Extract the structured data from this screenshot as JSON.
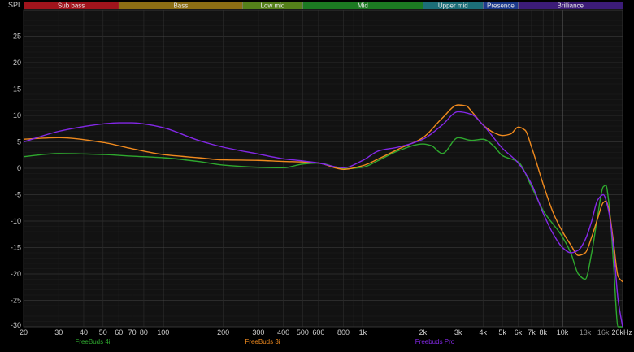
{
  "chart_data": {
    "type": "line",
    "ylabel": "SPL",
    "xunit": "kHz",
    "xscale": "log",
    "xlim": [
      20,
      20000
    ],
    "ylim": [
      -30,
      30
    ],
    "grid": true,
    "legend_placement": "bottom",
    "yticks": [
      25,
      20,
      15,
      10,
      5,
      0,
      -5,
      -10,
      -15,
      -20,
      -25,
      -30
    ],
    "xticks": [
      {
        "value": 20,
        "label": "20"
      },
      {
        "value": 30,
        "label": "30"
      },
      {
        "value": 40,
        "label": "40"
      },
      {
        "value": 50,
        "label": "50"
      },
      {
        "value": 60,
        "label": "60"
      },
      {
        "value": 70,
        "label": "70"
      },
      {
        "value": 80,
        "label": "80"
      },
      {
        "value": 100,
        "label": "100"
      },
      {
        "value": 200,
        "label": "200"
      },
      {
        "value": 300,
        "label": "300"
      },
      {
        "value": 400,
        "label": "400"
      },
      {
        "value": 500,
        "label": "500"
      },
      {
        "value": 600,
        "label": "600"
      },
      {
        "value": 800,
        "label": "800"
      },
      {
        "value": 1000,
        "label": "1k"
      },
      {
        "value": 2000,
        "label": "2k"
      },
      {
        "value": 3000,
        "label": "3k"
      },
      {
        "value": 4000,
        "label": "4k"
      },
      {
        "value": 5000,
        "label": "5k"
      },
      {
        "value": 6000,
        "label": "6k"
      },
      {
        "value": 7000,
        "label": "7k"
      },
      {
        "value": 8000,
        "label": "8k"
      },
      {
        "value": 10000,
        "label": "10k"
      },
      {
        "value": 13000,
        "label": "13k"
      },
      {
        "value": 16000,
        "label": "16k"
      },
      {
        "value": 20000,
        "label": "20kHz"
      }
    ],
    "bands": [
      {
        "label": "Sub bass",
        "from": 20,
        "to": 60,
        "color": "#a0141c"
      },
      {
        "label": "Bass",
        "from": 60,
        "to": 250,
        "color": "#8c6e14"
      },
      {
        "label": "Low mid",
        "from": 250,
        "to": 500,
        "color": "#55801a"
      },
      {
        "label": "Mid",
        "from": 500,
        "to": 2000,
        "color": "#1c7a22"
      },
      {
        "label": "Upper mid",
        "from": 2000,
        "to": 4000,
        "color": "#1c6e78"
      },
      {
        "label": "Presence",
        "from": 4000,
        "to": 6000,
        "color": "#1c3a8c"
      },
      {
        "label": "Brilliance",
        "from": 6000,
        "to": 20000,
        "color": "#3c1c78"
      }
    ],
    "series": [
      {
        "name": "FreeBuds 4i",
        "color": "#2ea82e",
        "x": [
          20,
          30,
          50,
          70,
          100,
          150,
          200,
          300,
          400,
          500,
          600,
          800,
          1000,
          1200,
          1500,
          2000,
          2200,
          2500,
          3000,
          3500,
          4000,
          4500,
          5000,
          6000,
          7000,
          8000,
          10000,
          11000,
          12000,
          13000,
          14000,
          15000,
          16000,
          16500,
          17000,
          17500,
          18000,
          19000,
          20000
        ],
        "y": [
          2.2,
          2.8,
          2.6,
          2.3,
          2.0,
          1.3,
          0.6,
          0.2,
          0.1,
          0.8,
          1.0,
          -0.1,
          0.2,
          1.5,
          3.3,
          4.6,
          4.3,
          2.8,
          5.8,
          5.3,
          5.5,
          4.3,
          2.4,
          1.2,
          -3.5,
          -8.0,
          -13.0,
          -16.0,
          -20.0,
          -21.0,
          -16.0,
          -9.0,
          -3.5,
          -3.2,
          -6.0,
          -11.0,
          -18.0,
          -30.0,
          -30.0
        ]
      },
      {
        "name": "FreeBuds 3i",
        "color": "#f08a1e",
        "x": [
          20,
          30,
          50,
          70,
          100,
          150,
          200,
          300,
          400,
          500,
          600,
          800,
          1000,
          1200,
          1500,
          2000,
          2500,
          3000,
          3300,
          3500,
          4000,
          4500,
          5000,
          5500,
          6000,
          6500,
          7000,
          8000,
          9000,
          10000,
          11000,
          12000,
          13000,
          14000,
          15000,
          16000,
          16500,
          17000,
          18000,
          19000,
          20000
        ],
        "y": [
          5.5,
          5.8,
          4.9,
          3.7,
          2.6,
          2.0,
          1.6,
          1.5,
          1.3,
          1.2,
          1.0,
          -0.2,
          0.5,
          1.8,
          3.6,
          5.8,
          9.5,
          12.0,
          11.8,
          10.8,
          8.2,
          6.8,
          6.2,
          6.5,
          7.8,
          7.2,
          4.0,
          -3.0,
          -8.5,
          -12.0,
          -14.5,
          -16.5,
          -16.0,
          -13.0,
          -9.5,
          -6.5,
          -6.2,
          -7.5,
          -14.0,
          -20.5,
          -21.5
        ]
      },
      {
        "name": "Freebuds Pro",
        "color": "#8428e8",
        "x": [
          20,
          30,
          40,
          50,
          60,
          70,
          80,
          100,
          150,
          200,
          300,
          400,
          500,
          600,
          800,
          1000,
          1200,
          1500,
          2000,
          2500,
          3000,
          3500,
          4000,
          5000,
          6000,
          7000,
          8000,
          9000,
          10000,
          11000,
          12000,
          13000,
          14000,
          15000,
          16000,
          17000,
          18000,
          19000,
          20000
        ],
        "y": [
          5.0,
          7.0,
          7.9,
          8.4,
          8.6,
          8.6,
          8.4,
          7.7,
          5.3,
          4.0,
          2.7,
          1.8,
          1.4,
          1.0,
          0.1,
          1.5,
          3.3,
          4.0,
          5.5,
          8.2,
          10.7,
          10.2,
          8.2,
          3.8,
          1.0,
          -3.0,
          -8.5,
          -12.5,
          -15.0,
          -16.0,
          -15.5,
          -13.5,
          -10.0,
          -6.0,
          -5.0,
          -8.0,
          -15.0,
          -25.0,
          -30.0
        ]
      }
    ]
  }
}
